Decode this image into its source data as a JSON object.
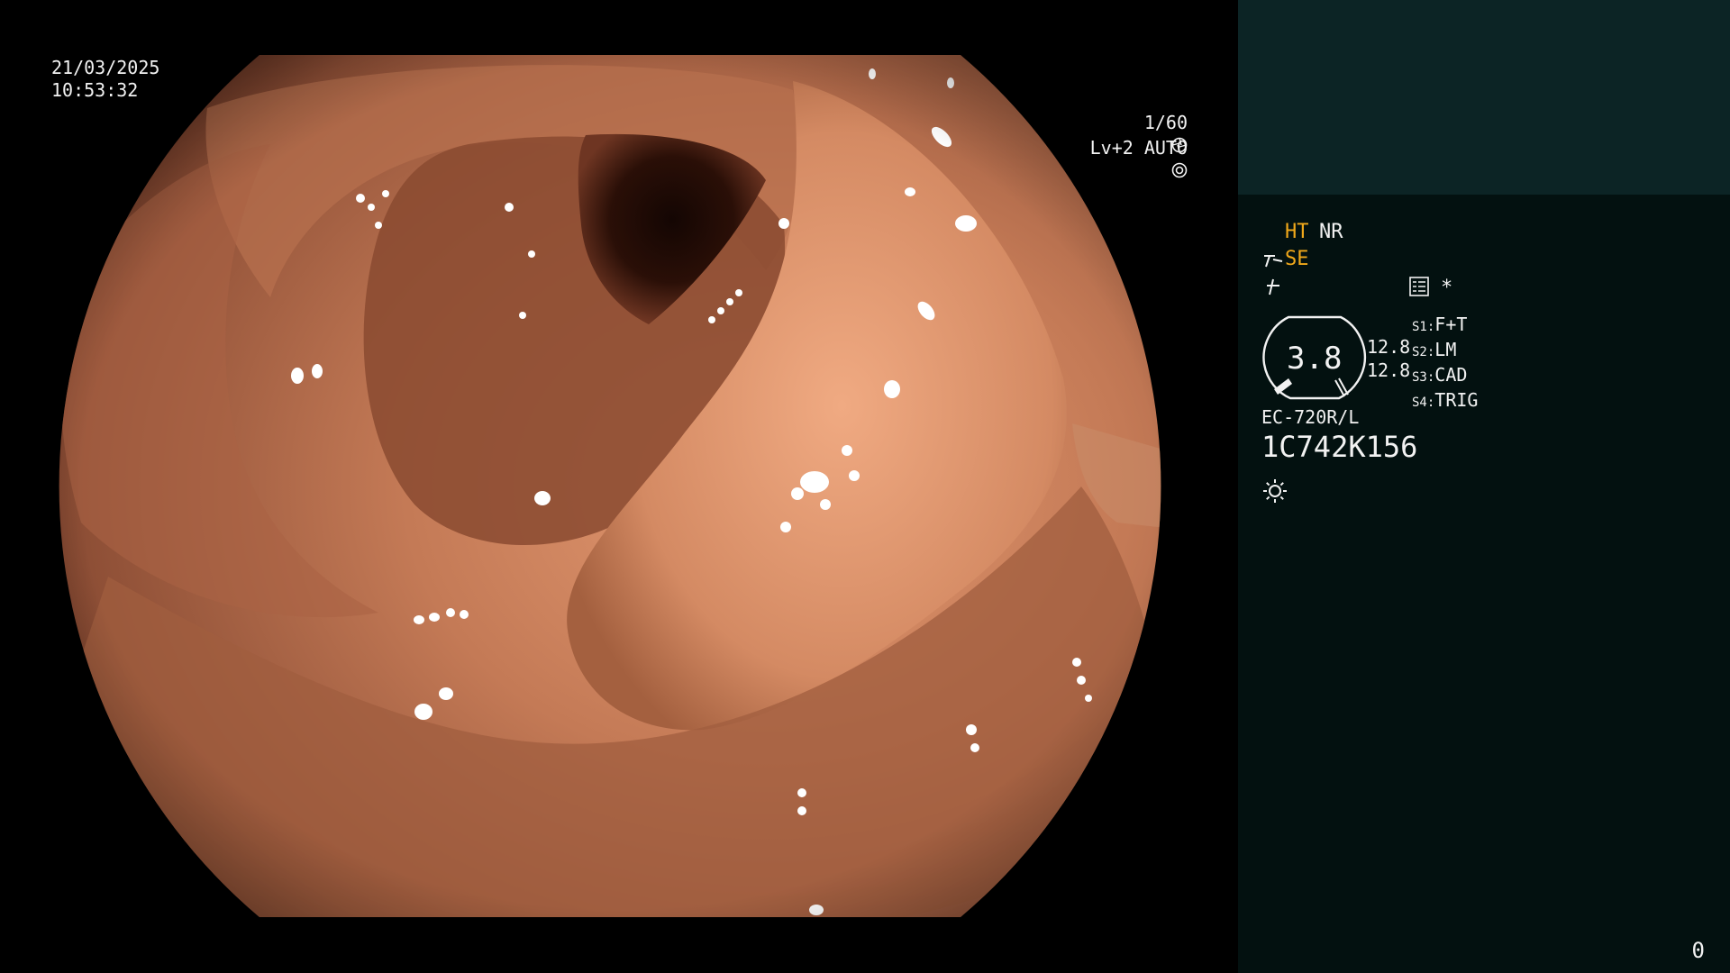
{
  "osd": {
    "date": "21/03/2025",
    "time": "10:53:32",
    "shutter": "1/60",
    "shutter_icon": "aperture-icon",
    "level": "Lv+2 AUTO",
    "level_icon": "iris-icon"
  },
  "panel": {
    "ht": "HT",
    "nr": "NR",
    "se": "SE",
    "se_icon": "structure-enhance-icon",
    "freeze_icon": "freeze-icon",
    "menu_icon": "menu-list-icon",
    "asterisk": "*",
    "zoom_value": "3.8",
    "values": [
      "12.8",
      "12.8"
    ],
    "switches": [
      {
        "key": "S1",
        "label": "F+T"
      },
      {
        "key": "S2",
        "label": "LM"
      },
      {
        "key": "S3",
        "label": "CAD"
      },
      {
        "key": "S4",
        "label": "TRIG"
      }
    ],
    "scope_model": "EC-720R/L",
    "serial": "1C742K156",
    "light_icon": "light-source-icon",
    "frame_counter": "0"
  },
  "colors": {
    "highlight": "#f0a81a",
    "panel_bg": "#031110",
    "panel_top_bg": "#0c2425",
    "mucosa": "#b96c4b"
  }
}
